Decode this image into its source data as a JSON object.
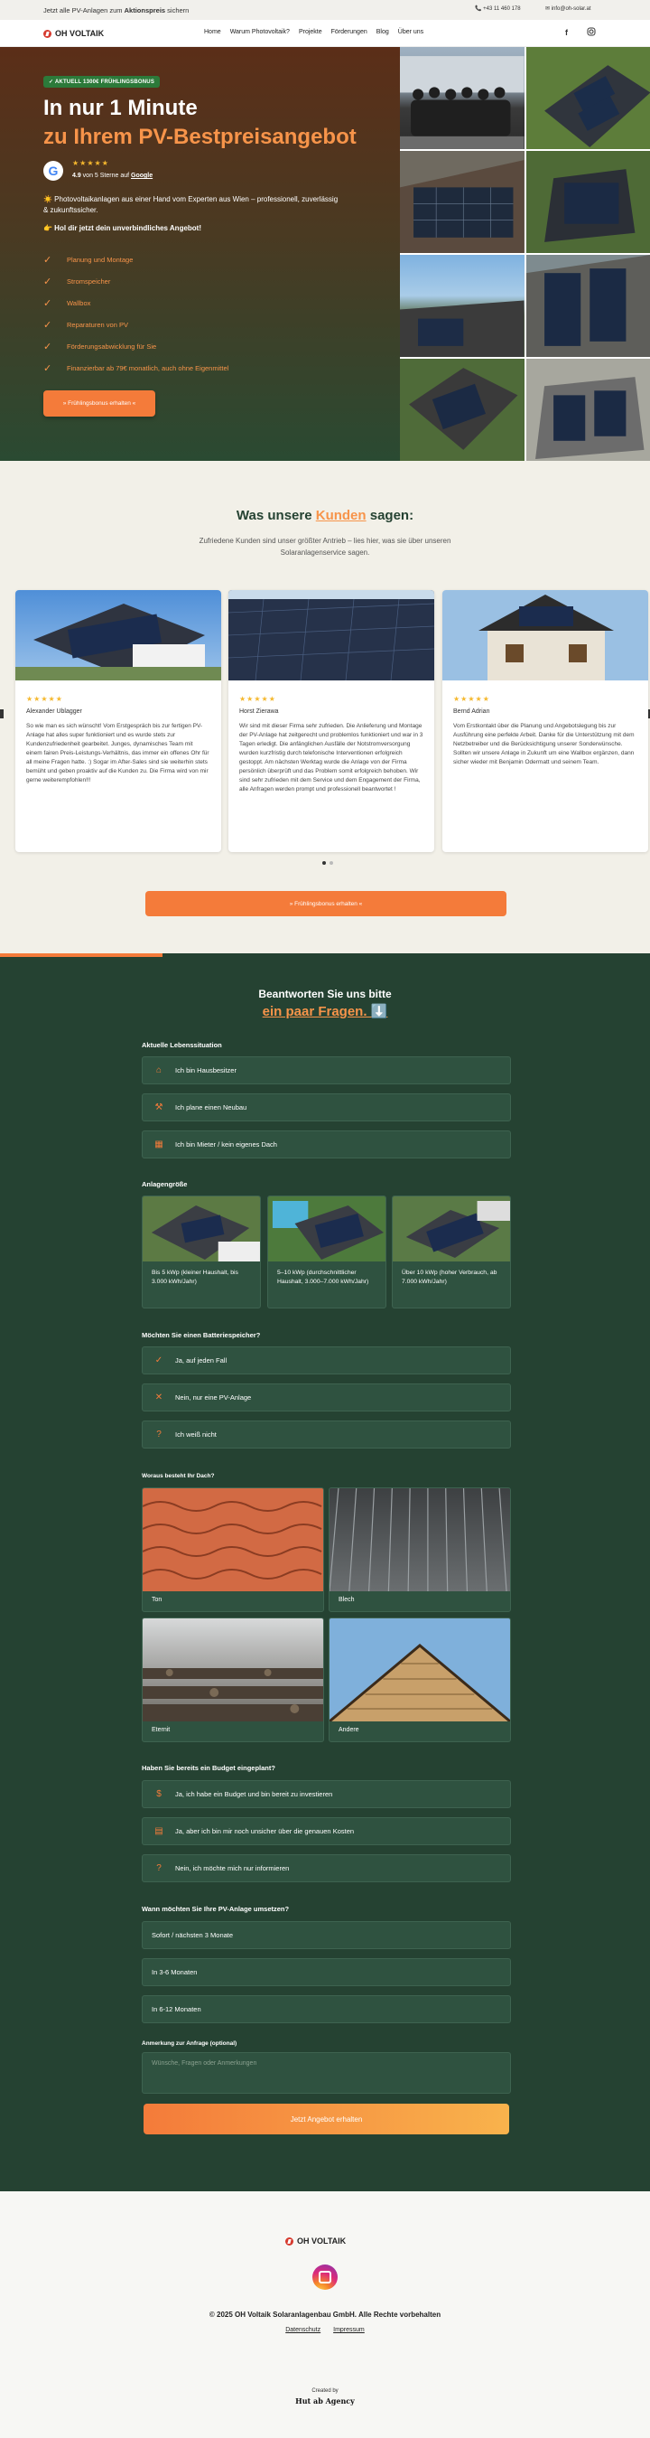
{
  "topbar": {
    "promo_pre": "Jetzt alle PV-Anlagen zum ",
    "promo_bold": "Aktionspreis",
    "promo_post": " sichern",
    "phone": "+43 11 460 178",
    "email": "info@oh-solar.at"
  },
  "nav": {
    "logo": "OH VOLTAIK",
    "links": [
      "Home",
      "Warum Photovoltaik?",
      "Projekte",
      "Förderungen",
      "Blog",
      "Über uns"
    ]
  },
  "hero": {
    "badge": "AKTUELL 1300€ FRÜHLINGSBONUS",
    "title_1": "In nur 1 Minute",
    "title_2": "zu Ihrem PV-Bestpreisangebot",
    "google_letter": "G",
    "stars": "★★★★★",
    "rating_pre": "4.9",
    "rating_mid": " von 5 Sterne auf ",
    "rating_brand": "Google",
    "intro": "☀️ Photovoltaikanlagen aus einer Hand vom Experten aus Wien – professionell, zuverlässig & zukunftssicher.",
    "hot": "👉 Hol dir jetzt dein unverbindliches Angebot!",
    "checklist": [
      "Planung und Montage",
      "Stromspeicher",
      "Wallbox",
      "Reparaturen von PV",
      "Förderungsabwicklung für Sie",
      "Finanzierbar ab 79€ monatlich, auch ohne Eigenmittel"
    ],
    "cta": "» Frühlingsbonus erhalten «"
  },
  "reviews": {
    "title_pre": "Was unsere ",
    "title_hl": "Kunden",
    "title_post": " sagen:",
    "subtitle": "Zufriedene Kunden sind unser größter Antrieb – lies hier, was sie über unseren Solaranlagenservice sagen.",
    "items": [
      {
        "stars": "★★★★★",
        "name": "Alexander Ublagger",
        "text": "So wie man es sich wünscht! Vom Erstgespräch bis zur fertigen PV-Anlage hat alles super funktioniert und es wurde stets zur Kundenzufriedenheit gearbeitet. Junges, dynamisches Team mit einem fairen Preis-Leistungs-Verhältnis, das immer ein offenes Ohr für all meine Fragen hatte. :) Sogar im After-Sales sind sie weiterhin stets bemüht und geben proaktiv auf die Kunden zu. Die Firma wird von mir gerne weiterempfohlen!!!"
      },
      {
        "stars": "★★★★★",
        "name": "Horst Zierawa",
        "text": "Wir sind mit dieser Firma sehr zufrieden. Die Anlieferung und Montage der PV-Anlage hat zeitgerecht und problemlos funktioniert und war in 3 Tagen erledigt. Die anfänglichen Ausfälle der Notstromversorgung wurden kurzfristig durch telefonische Interventionen erfolgreich gestoppt. Am nächsten Werktag wurde die Anlage von der Firma persönlich überprüft und das Problem somit erfolgreich behoben. Wir sind sehr zufrieden mit dem Service und dem Engagement der Firma, alle Anfragen werden prompt und professionell beantwortet !"
      },
      {
        "stars": "★★★★★",
        "name": "Bernd Adrian",
        "text": "Vom Erstkontakt über die Planung und Angebotslegung bis zur Ausführung eine perfekte Arbeit. Danke für die Unterstützung mit dem Netzbetreiber und die Berücksichtigung unserer Sonderwünsche. Sollten wir unsere Anlage in Zukunft um eine Wallbox ergänzen, dann sicher wieder mit Benjamin Odermatt und seinem Team."
      }
    ],
    "cta": "» Frühlingsbonus erhalten «"
  },
  "form": {
    "progress": 0.25,
    "title": "Beantworten Sie uns bitte",
    "title_hl": "ein paar Fragen. ⬇️",
    "q1": "Aktuelle Lebenssituation",
    "q1_opts": [
      "Ich bin Hausbesitzer",
      "Ich plane einen Neubau",
      "Ich bin Mieter / kein eigenes Dach"
    ],
    "q2": "Anlagengröße",
    "q2_opts": [
      "Bis 5 kWp (kleiner Haushalt, bis 3.000 kWh/Jahr)",
      "5–10 kWp (durchschnittlicher Haushalt, 3.000–7.000 kWh/Jahr)",
      "Über 10 kWp (hoher Verbrauch, ab 7.000 kWh/Jahr)"
    ],
    "q3": "Möchten Sie einen Batteriespeicher?",
    "q3_opts": [
      "Ja, auf jeden Fall",
      "Nein, nur eine PV-Anlage",
      "Ich weiß nicht"
    ],
    "q4": "Woraus besteht Ihr Dach?",
    "q4_opts": [
      "Ton",
      "Blech",
      "Eternit",
      "Andere"
    ],
    "q5": "Haben Sie bereits ein Budget eingeplant?",
    "q5_opts": [
      "Ja, ich habe ein Budget und bin bereit zu investieren",
      "Ja, aber ich bin mir noch unsicher über die genauen Kosten",
      "Nein, ich möchte mich nur informieren"
    ],
    "q6": "Wann möchten Sie Ihre PV-Anlage umsetzen?",
    "q6_opts": [
      "Sofort / nächsten 3 Monate",
      "In 3-6 Monaten",
      "In 6-12 Monaten"
    ],
    "q7": "Anmerkung zur Anfrage (optional)",
    "note_placeholder": "Wünsche, Fragen oder Anmerkungen",
    "submit": "Jetzt Angebot erhalten"
  },
  "footer": {
    "logo": "OH VOLTAIK",
    "copyright": "© 2025 OH Voltaik Solaranlagenbau GmbH. Alle Rechte vorbehalten",
    "links": [
      "Datenschutz",
      "Impressum"
    ],
    "created": "Created by",
    "agency": "Hut ab Agency"
  },
  "colors": {
    "accent": "#f47b3a",
    "dark_green": "#254232",
    "hero_brown": "#5b2e18"
  }
}
